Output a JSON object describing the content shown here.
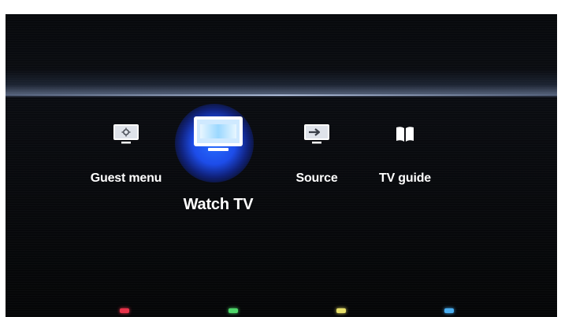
{
  "menu": {
    "items": [
      {
        "label": "Guest menu",
        "icon": "settings-monitor-icon",
        "selected": false
      },
      {
        "label": "Watch TV",
        "icon": "tv-icon",
        "selected": true
      },
      {
        "label": "Source",
        "icon": "source-input-icon",
        "selected": false
      },
      {
        "label": "TV guide",
        "icon": "book-guide-icon",
        "selected": false
      }
    ]
  },
  "color_keys": [
    {
      "name": "red",
      "color": "#e8334a"
    },
    {
      "name": "green",
      "color": "#4fd66a"
    },
    {
      "name": "yellow",
      "color": "#e8e06a"
    },
    {
      "name": "blue",
      "color": "#4aaef0"
    }
  ],
  "colors": {
    "background": "#060708",
    "selection_glow": "#2a6cff",
    "text": "#ffffff"
  }
}
